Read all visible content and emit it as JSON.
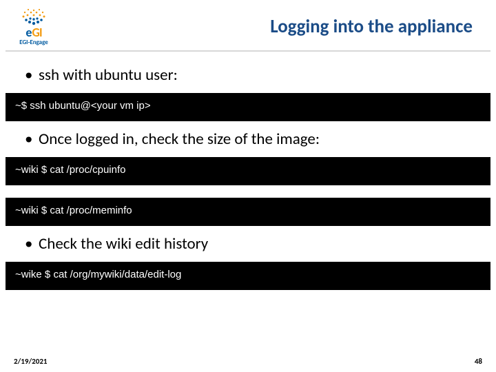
{
  "header": {
    "title": "Logging into the appliance",
    "logo_brand_e": "e",
    "logo_brand_gi": "GI",
    "logo_sub": "EGI-Engage"
  },
  "bullets": {
    "b1": "ssh with ubuntu user:",
    "b2": "Once logged in, check the size of the image:",
    "b3": "Check the wiki edit history"
  },
  "terminals": {
    "t1": "~$ ssh ubuntu@<your vm ip>",
    "t2": "~wiki $ cat /proc/cpuinfo",
    "t3": "~wiki $ cat /proc/meminfo",
    "t4": "~wike $ cat /org/mywiki/data/edit-log"
  },
  "footer": {
    "date": "2/19/2021",
    "page": "48"
  }
}
